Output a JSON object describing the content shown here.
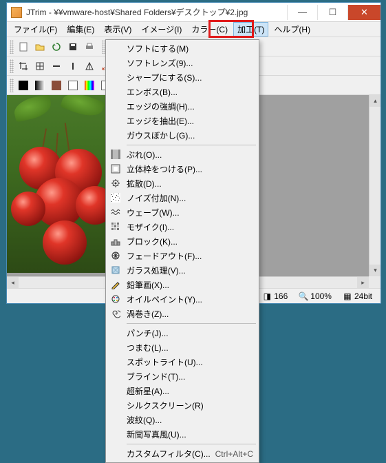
{
  "window": {
    "title": "JTrim - ¥¥vmware-host¥Shared Folders¥デスクトップ¥2.jpg"
  },
  "menubar": {
    "items": [
      "ファイル(F)",
      "編集(E)",
      "表示(V)",
      "イメージ(I)",
      "カラー(C)",
      "加工(T)",
      "ヘルプ(H)"
    ],
    "active_index": 5
  },
  "dropdown": {
    "groups": [
      [
        {
          "label": "ソフトにする(M)",
          "icon": ""
        },
        {
          "label": "ソフトレンズ(9)...",
          "icon": ""
        },
        {
          "label": "シャープにする(S)...",
          "icon": ""
        },
        {
          "label": "エンボス(B)...",
          "icon": ""
        },
        {
          "label": "エッジの強調(H)...",
          "icon": ""
        },
        {
          "label": "エッジを抽出(E)...",
          "icon": ""
        },
        {
          "label": "ガウスぼかし(G)...",
          "icon": ""
        }
      ],
      [
        {
          "label": "ぶれ(O)...",
          "icon": "blur"
        },
        {
          "label": "立体枠をつける(P)...",
          "icon": "frame"
        },
        {
          "label": "拡散(D)...",
          "icon": "scatter"
        },
        {
          "label": "ノイズ付加(N)...",
          "icon": "noise"
        },
        {
          "label": "ウェーブ(W)...",
          "icon": "wave"
        },
        {
          "label": "モザイク(I)...",
          "icon": "mosaic"
        },
        {
          "label": "ブロック(K)...",
          "icon": "block"
        },
        {
          "label": "フェードアウト(F)...",
          "icon": "fade"
        },
        {
          "label": "ガラス処理(V)...",
          "icon": "glass"
        },
        {
          "label": "鉛筆画(X)...",
          "icon": "pencil"
        },
        {
          "label": "オイルペイント(Y)...",
          "icon": "oil"
        },
        {
          "label": "渦巻き(Z)...",
          "icon": "spiral"
        }
      ],
      [
        {
          "label": "パンチ(J)...",
          "icon": ""
        },
        {
          "label": "つまむ(L)...",
          "icon": ""
        },
        {
          "label": "スポットライト(U)...",
          "icon": ""
        },
        {
          "label": "ブラインド(T)...",
          "icon": ""
        },
        {
          "label": "超新星(A)...",
          "icon": ""
        },
        {
          "label": "シルクスクリーン(R)",
          "icon": ""
        },
        {
          "label": "波紋(Q)...",
          "icon": ""
        },
        {
          "label": "新聞写真風(U)...",
          "icon": ""
        }
      ],
      [
        {
          "label": "カスタムフィルタ(C)...",
          "icon": "",
          "shortcut": "Ctrl+Alt+C"
        }
      ]
    ]
  },
  "statusbar": {
    "dim": "166",
    "zoom": "100%",
    "depth": "24bit"
  },
  "icons": {
    "magnifier": "🔍",
    "grid": "▦",
    "ruler": "◫"
  }
}
